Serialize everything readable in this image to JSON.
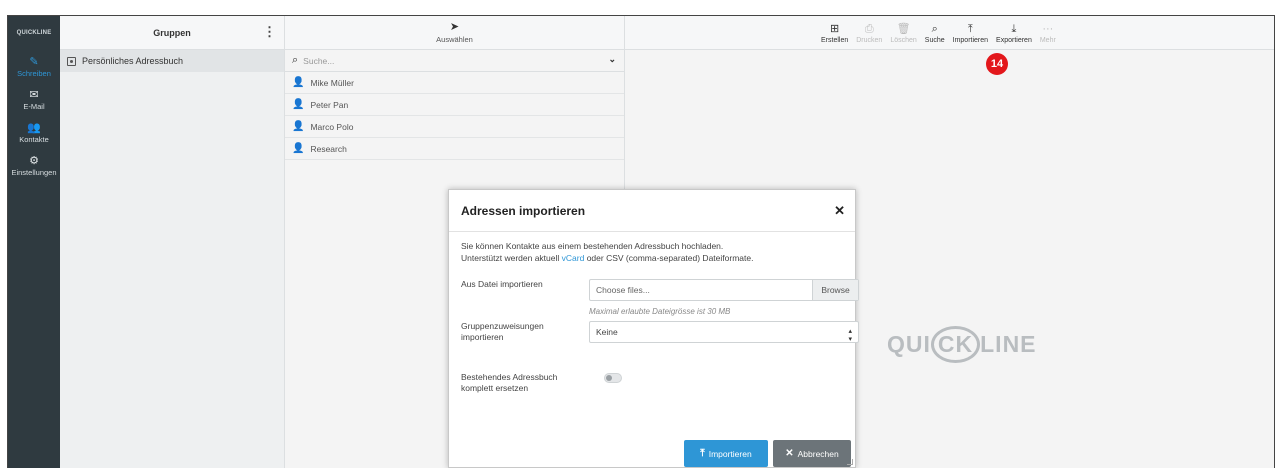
{
  "brand": "QUICKLINE",
  "nav": [
    {
      "label": "Schreiben",
      "icon": "edit-icon",
      "glyph": "✎",
      "active": true
    },
    {
      "label": "E-Mail",
      "icon": "envelope-icon",
      "glyph": "✉",
      "active": false
    },
    {
      "label": "Kontakte",
      "icon": "contacts-icon",
      "glyph": "👥",
      "active": false
    },
    {
      "label": "Einstellungen",
      "icon": "gear-icon",
      "glyph": "⚙",
      "active": false
    }
  ],
  "groups": {
    "title": "Gruppen",
    "items": [
      {
        "label": "Persönliches Adressbuch"
      }
    ]
  },
  "contacts": {
    "select_label": "Auswählen",
    "search_placeholder": "Suche...",
    "items": [
      {
        "name": "Mike Müller"
      },
      {
        "name": "Peter Pan"
      },
      {
        "name": "Marco Polo"
      },
      {
        "name": "Research"
      }
    ]
  },
  "toolbar": [
    {
      "label": "Erstellen",
      "icon": "plus-square-icon",
      "glyph": "⊞",
      "disabled": false
    },
    {
      "label": "Drucken",
      "icon": "print-icon",
      "glyph": "⎙",
      "disabled": true
    },
    {
      "label": "Löschen",
      "icon": "trash-icon",
      "glyph": "🗑",
      "disabled": true
    },
    {
      "label": "Suche",
      "icon": "search-icon",
      "glyph": "⌕",
      "disabled": false
    },
    {
      "label": "Importieren",
      "icon": "upload-icon",
      "glyph": "⤒",
      "disabled": false
    },
    {
      "label": "Exportieren",
      "icon": "download-icon",
      "glyph": "⤓",
      "disabled": false
    },
    {
      "label": "Mehr",
      "icon": "more-icon",
      "glyph": "···",
      "disabled": true
    }
  ],
  "marker": "14",
  "watermark": "QUICKLINE",
  "modal": {
    "title": "Adressen importieren",
    "intro_line1": "Sie können Kontakte aus einem bestehenden Adressbuch hochladen.",
    "intro_line2_pre": "Unterstützt werden aktuell ",
    "intro_link": "vCard",
    "intro_line2_post": " oder CSV (comma-separated) Dateiformate.",
    "file_label": "Aus Datei importieren",
    "file_placeholder": "Choose files...",
    "browse": "Browse",
    "file_hint": "Maximal erlaubte Dateigrösse ist 30 MB",
    "groups_label": "Gruppenzuweisungen importieren",
    "groups_value": "Keine",
    "replace_label": "Bestehendes Adressbuch komplett ersetzen",
    "replace_checked": false,
    "import_button": "Importieren",
    "cancel_button": "Abbrechen"
  },
  "colors": {
    "accent": "#2e96d6",
    "nav_bg": "#2f3a40",
    "marker": "#e3171b"
  }
}
